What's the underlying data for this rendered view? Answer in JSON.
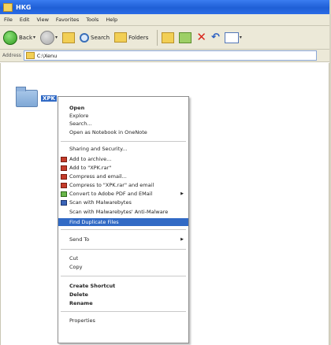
{
  "window": {
    "title": "HKG"
  },
  "menubar": [
    "File",
    "Edit",
    "View",
    "Favorites",
    "Tools",
    "Help"
  ],
  "toolbar": {
    "back_label": "Back",
    "search_label": "Search",
    "folders_label": "Folders"
  },
  "addressbar": {
    "label": "Address",
    "path": "C:\\Xenu"
  },
  "folder_item": {
    "label": "XPK"
  },
  "context_menu": {
    "items": [
      {
        "label": "Open",
        "bold": false
      },
      {
        "label": "Explore",
        "bold": false
      },
      {
        "label": "Search...",
        "bold": false
      },
      {
        "label": "Open as Notebook in OneNote",
        "bold": false
      },
      {
        "label": "Sharing and Security...",
        "bold": false
      },
      {
        "label": "Add to archive...",
        "icon": "winrar-icon"
      },
      {
        "label": "Add to \"XPK.rar\"",
        "icon": "winrar-icon"
      },
      {
        "label": "Compress and email...",
        "icon": "winrar-icon"
      },
      {
        "label": "Compress to \"XPK.rar\" and email",
        "icon": "winrar-icon"
      },
      {
        "label": "Convert to Adobe PDF and EMail",
        "icon": "pdf-convert-icon",
        "submenu": true
      },
      {
        "label": "Scan with Malwarebytes",
        "icon": "scan-icon"
      },
      {
        "label": "Scan with Malwarebytes' Anti-Malware"
      },
      {
        "label": "Find Duplicate Files",
        "highlighted": true
      },
      {
        "label": "Send To",
        "submenu": true
      },
      {
        "label": "Cut"
      },
      {
        "label": "Copy"
      },
      {
        "label": "Create Shortcut",
        "bold": true
      },
      {
        "label": "Delete",
        "bold": true
      },
      {
        "label": "Rename",
        "bold": true
      },
      {
        "label": "Properties"
      }
    ]
  },
  "colors": {
    "highlight": "#316ac5",
    "titlebar": "#2a6be6",
    "chrome": "#ece9d8"
  }
}
